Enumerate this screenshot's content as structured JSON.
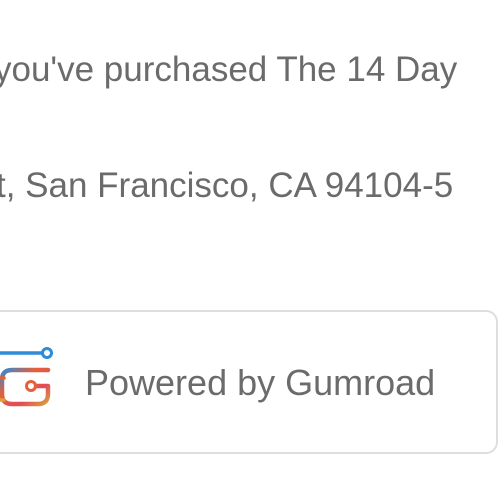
{
  "footer": {
    "purchase_text": "you've purchased The 14 Day",
    "address_text": "t, San Francisco, CA 94104-5"
  },
  "badge": {
    "label": "Powered by Gumroad",
    "icon": "gumroad-icon"
  }
}
